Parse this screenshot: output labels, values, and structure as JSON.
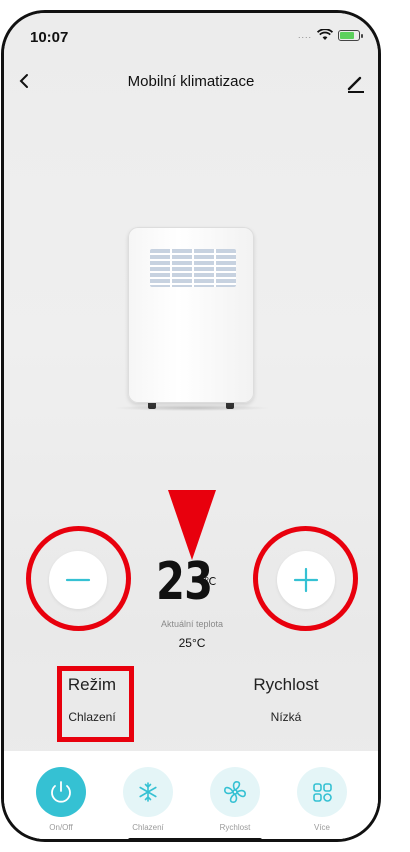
{
  "status_bar": {
    "time": "10:07",
    "signal": "....",
    "wifi_icon": "wifi-icon",
    "battery_icon": "battery-charging-icon"
  },
  "nav": {
    "title": "Mobilní klimatizace",
    "back_icon": "chevron-left-icon",
    "edit_icon": "pencil-icon"
  },
  "device": {
    "image": "portable-air-conditioner-illustration"
  },
  "temperature": {
    "target": "23",
    "unit": "℃",
    "caption": "Aktuální teplota",
    "current": "25°C",
    "decrease_icon": "minus-icon",
    "increase_icon": "plus-icon"
  },
  "mode": {
    "label": "Režim",
    "value": "Chlazení"
  },
  "speed": {
    "label": "Rychlost",
    "value": "Nízká"
  },
  "tabs": [
    {
      "label": "On/Off",
      "icon": "power-icon",
      "active": true
    },
    {
      "label": "Chlazení",
      "icon": "snowflake-icon",
      "active": false
    },
    {
      "label": "Rychlost",
      "icon": "fan-icon",
      "active": false
    },
    {
      "label": "Více",
      "icon": "grid-icon",
      "active": false
    }
  ],
  "colors": {
    "accent": "#35c1d3",
    "accent_light": "#e4f5f7",
    "annotation_red": "#e8000d"
  }
}
